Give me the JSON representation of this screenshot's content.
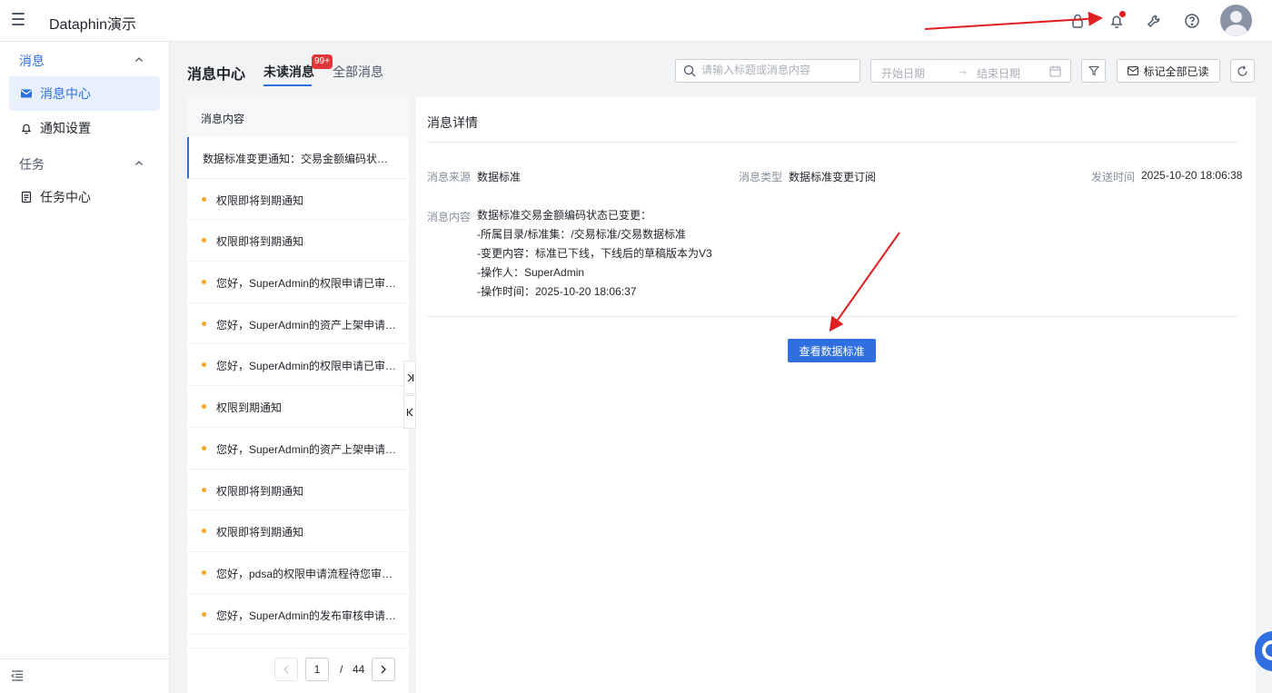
{
  "app": {
    "title": "Dataphin演示"
  },
  "topbar": {
    "icons": [
      "menu-icon",
      "lock-icon",
      "bell-icon",
      "wrench-icon",
      "help-icon",
      "avatar"
    ],
    "notification_dot_color": "#e02020"
  },
  "sidebar": {
    "groups": [
      {
        "label": "消息",
        "expanded": true
      },
      {
        "label": "任务",
        "expanded": true
      }
    ],
    "items": [
      {
        "label": "消息中心",
        "icon": "mail-icon",
        "selected": true
      },
      {
        "label": "通知设置",
        "icon": "bell-icon",
        "selected": false
      },
      {
        "label": "任务中心",
        "icon": "document-icon",
        "selected": false
      }
    ]
  },
  "header": {
    "title": "消息中心",
    "tabs": [
      {
        "label": "未读消息",
        "active": true,
        "badge": "99+"
      },
      {
        "label": "全部消息",
        "active": false
      }
    ],
    "search": {
      "placeholder": "请输入标题或消息内容",
      "value": ""
    },
    "date_range": {
      "start_placeholder": "开始日期",
      "separator": "→",
      "end_placeholder": "结束日期"
    },
    "mark_all_label": "标记全部已读"
  },
  "list": {
    "header": "消息内容",
    "items": [
      "数据标准变更通知：交易金额编码状态已变更",
      "权限即将到期通知",
      "权限即将到期通知",
      "您好，SuperAdmin的权限申请已审批通过",
      "您好，SuperAdmin的资产上架申请已审批",
      "您好，SuperAdmin的权限申请已审批通过",
      "权限到期通知",
      "您好，SuperAdmin的资产上架申请已审批",
      "权限即将到期通知",
      "权限即将到期通知",
      "您好，pdsa的权限申请流程待您审批，请及时处理",
      "您好，SuperAdmin的发布审核申请已审批"
    ],
    "pagination": {
      "current": "1",
      "separator": "/",
      "total": "44"
    }
  },
  "detail": {
    "title": "消息详情",
    "source_label": "消息来源",
    "source": "数据标准",
    "type_label": "消息类型",
    "type": "数据标准变更订阅",
    "time_label": "发送时间",
    "time": "2025-10-20 18:06:38",
    "content_label": "消息内容",
    "content_lines": [
      "数据标准交易金额编码状态已变更：",
      "-所属目录/标准集：/交易标准/交易数据标准",
      "-变更内容：标准已下线，下线后的草稿版本为V3",
      "-操作人：SuperAdmin",
      "-操作时间：2025-10-20 18:06:37"
    ],
    "action_label": "查看数据标准"
  },
  "colors": {
    "accent": "#2f6fe0",
    "badge": "#e0363a",
    "unread_dot": "#f5a623",
    "annotation_arrow": "#e02020"
  }
}
